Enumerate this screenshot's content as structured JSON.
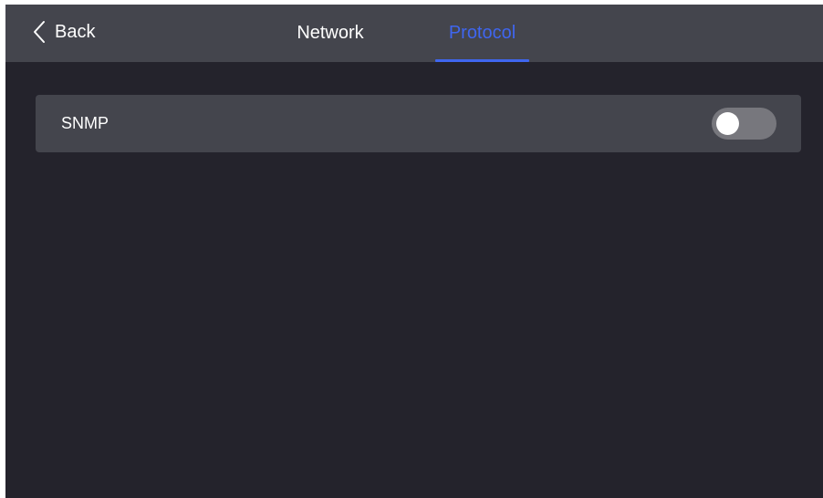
{
  "header": {
    "back_label": "Back",
    "tabs": [
      {
        "label": "Network",
        "active": false
      },
      {
        "label": "Protocol",
        "active": true
      }
    ]
  },
  "settings": {
    "items": [
      {
        "label": "SNMP",
        "toggle_on": false
      }
    ]
  },
  "colors": {
    "accent": "#3f66f0",
    "background": "#24232c",
    "bar": "#44454d",
    "toggle_track_off": "#77777d"
  },
  "icons": {
    "back": "chevron-left-icon"
  }
}
